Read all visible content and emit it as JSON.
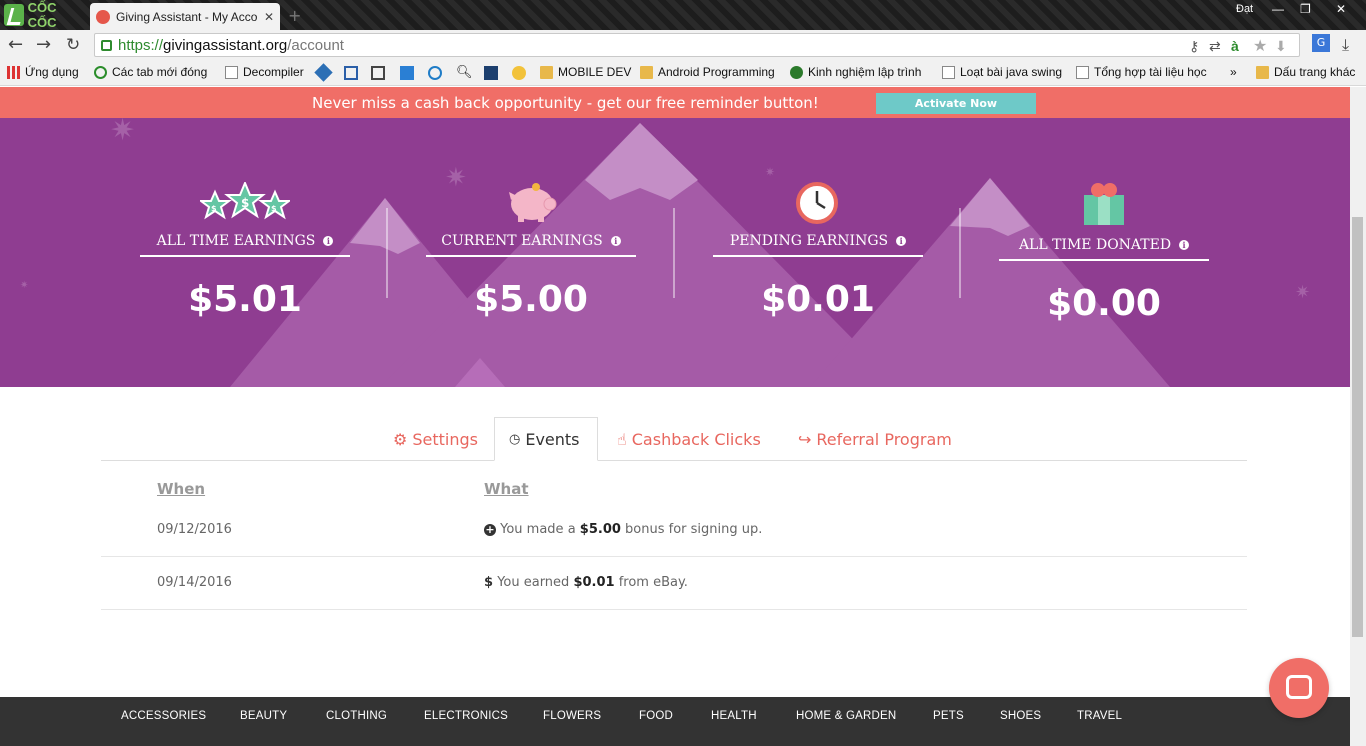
{
  "browser": {
    "brand": "CỐC CỐC",
    "tab_title": "Giving Assistant - My Acco",
    "user_name": "Đạt",
    "url_scheme": "https://",
    "url_host": "givingassistant.org",
    "url_path": "/account",
    "bookmarks": {
      "apps": "Ứng dụng",
      "closed_tabs": "Các tab mới đóng",
      "decompiler": "Decompiler",
      "mobile_dev": "MOBILE DEV",
      "android": "Android Programming",
      "kinh_nghiem": "Kinh nghiệm lập trình",
      "java_swing": "Loạt bài java swing",
      "tong_hop": "Tổng hợp tài liệu học",
      "more": "»",
      "other": "Dấu trang khác"
    }
  },
  "banner": {
    "message": "Never miss a cash back opportunity - get our free reminder button!",
    "button": "Activate Now"
  },
  "stats": [
    {
      "label": "ALL TIME EARNINGS",
      "value": "$5.01"
    },
    {
      "label": "CURRENT EARNINGS",
      "value": "$5.00"
    },
    {
      "label": "PENDING EARNINGS",
      "value": "$0.01"
    },
    {
      "label": "ALL TIME DONATED",
      "value": "$0.00"
    }
  ],
  "tabs": [
    {
      "label": "Settings"
    },
    {
      "label": "Events"
    },
    {
      "label": "Cashback Clicks"
    },
    {
      "label": "Referral Program"
    }
  ],
  "events": {
    "headers": {
      "when": "When",
      "what": "What"
    },
    "rows": [
      {
        "date": "09/12/2016",
        "pre": "You made a ",
        "amount": "$5.00",
        "post": " bonus for signing up."
      },
      {
        "date": "09/14/2016",
        "pre": "You earned ",
        "amount": "$0.01",
        "post": " from eBay."
      }
    ]
  },
  "footer": {
    "categories": [
      "ACCESSORIES",
      "BEAUTY",
      "CLOTHING",
      "ELECTRONICS",
      "FLOWERS",
      "FOOD",
      "HEALTH",
      "HOME & GARDEN",
      "PETS",
      "SHOES",
      "TRAVEL"
    ]
  },
  "colors": {
    "accent": "#f06e67",
    "hero": "#8f3d91",
    "teal": "#6ec9c8"
  }
}
